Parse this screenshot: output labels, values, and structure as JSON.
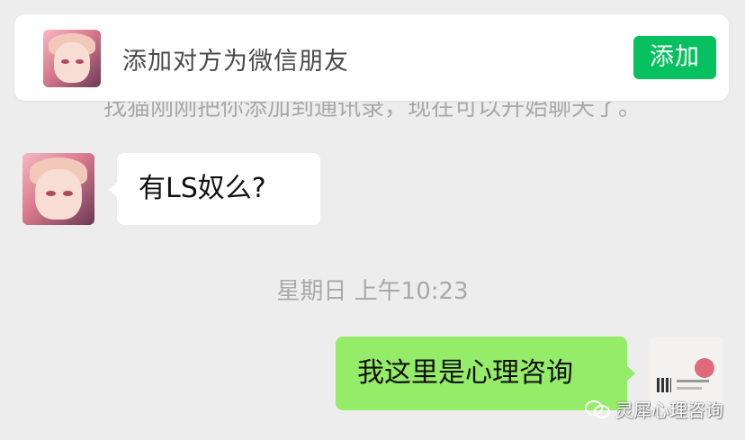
{
  "banner": {
    "text": "添加对方为微信朋友",
    "add_label": "添加"
  },
  "system_message": "找猫刚刚把你添加到通讯录，现在可以开始聊天了。",
  "messages": [
    {
      "direction": "incoming",
      "text": "有LS奴么?"
    },
    {
      "direction": "outgoing",
      "text": "我这里是心理咨询"
    }
  ],
  "timestamp": "星期日 上午10:23",
  "watermark": {
    "text": "灵犀心理咨询",
    "icon": "wechat-icon"
  },
  "colors": {
    "background": "#ededed",
    "add_button": "#07c160",
    "outgoing_bubble": "#95ec69",
    "incoming_bubble": "#ffffff"
  }
}
